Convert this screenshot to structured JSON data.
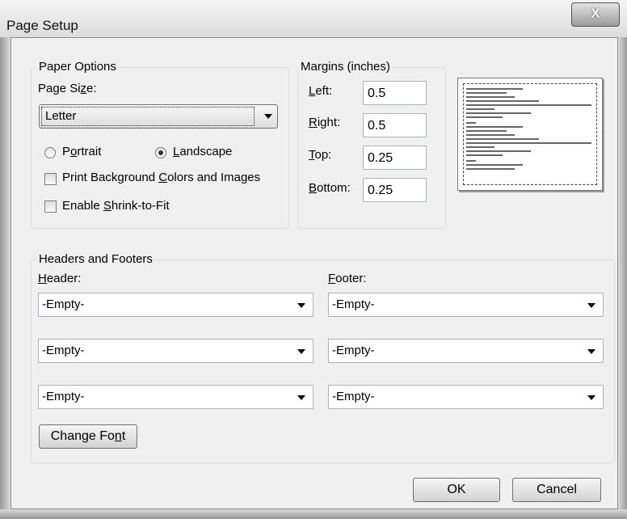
{
  "window": {
    "title": "Page Setup",
    "close_glyph": "X"
  },
  "paper_options": {
    "legend": "Paper Options",
    "page_size_label_pre": "Page Si",
    "page_size_label_accel": "z",
    "page_size_label_post": "e:",
    "page_size_value": "Letter",
    "orientation": {
      "portrait_pre": "P",
      "portrait_accel": "o",
      "portrait_post": "rtrait",
      "landscape_accel": "L",
      "landscape_post": "andscape",
      "selected": "Landscape"
    },
    "print_bg_pre": "Print Background ",
    "print_bg_accel": "C",
    "print_bg_post": "olors and Images",
    "shrink_pre": "Enable ",
    "shrink_accel": "S",
    "shrink_post": "hrink-to-Fit"
  },
  "margins": {
    "legend": "Margins (inches)",
    "left_accel": "L",
    "left_post": "eft:",
    "left_value": "0.5",
    "right_accel": "R",
    "right_post": "ight:",
    "right_value": "0.5",
    "top_accel": "T",
    "top_post": "op:",
    "top_value": "0.25",
    "bottom_accel": "B",
    "bottom_post": "ottom:",
    "bottom_value": "0.25"
  },
  "headers_footers": {
    "legend": "Headers and Footers",
    "header_accel": "H",
    "header_post": "eader:",
    "footer_accel": "F",
    "footer_post": "ooter:",
    "header_values": [
      "-Empty-",
      "-Empty-",
      "-Empty-"
    ],
    "footer_values": [
      "-Empty-",
      "-Empty-",
      "-Empty-"
    ],
    "change_font_pre": "Change Fo",
    "change_font_accel": "n",
    "change_font_post": "t"
  },
  "buttons": {
    "ok": "OK",
    "cancel": "Cancel"
  }
}
